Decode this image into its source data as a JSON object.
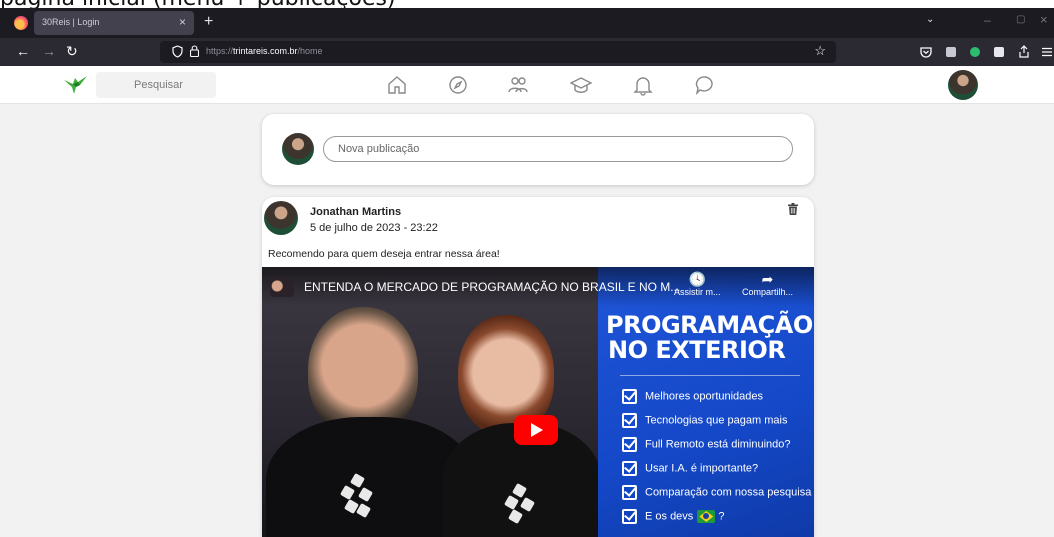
{
  "page_top_text": "página inicial (menu + publicações)",
  "browser": {
    "tab_title": "30Reis | Login",
    "tab_close": "×",
    "new_tab": "+",
    "tabs_list": "⌄",
    "min": "–",
    "max": "▢",
    "close": "×",
    "back": "←",
    "forward": "→",
    "reload": "↻",
    "url_scheme": "https://",
    "url_host": "trintareis.com.br",
    "url_path": "/home",
    "bookmark": "☆"
  },
  "app": {
    "search_placeholder": "Pesquisar"
  },
  "compose": {
    "placeholder": "Nova publicação"
  },
  "post": {
    "author": "Jonathan Martins",
    "date": "5 de julho de 2023 - 23:22",
    "text": "Recomendo para quem deseja entrar nessa área!",
    "video": {
      "title": "ENTENDA O MERCADO DE PROGRAMAÇÃO NO BRASIL E NO M...",
      "watch_later": "Assistir m...",
      "share": "Compartilh...",
      "headline_1": "PROGRAMAÇÃO",
      "headline_2": "NO EXTERIOR",
      "bullets": [
        "Melhores oportunidades",
        "Tecnologias que pagam mais",
        "Full Remoto está diminuindo?",
        "Usar I.A. é importante?",
        "Comparação com nossa pesquisa",
        "E os devs"
      ],
      "last_bullet_suffix": "?"
    }
  },
  "colors": {
    "browser_dark": "#1c1b22",
    "toolbar": "#2b2a33",
    "youtube_red": "#ff0000",
    "thumb_blue": "#1f55d8"
  }
}
